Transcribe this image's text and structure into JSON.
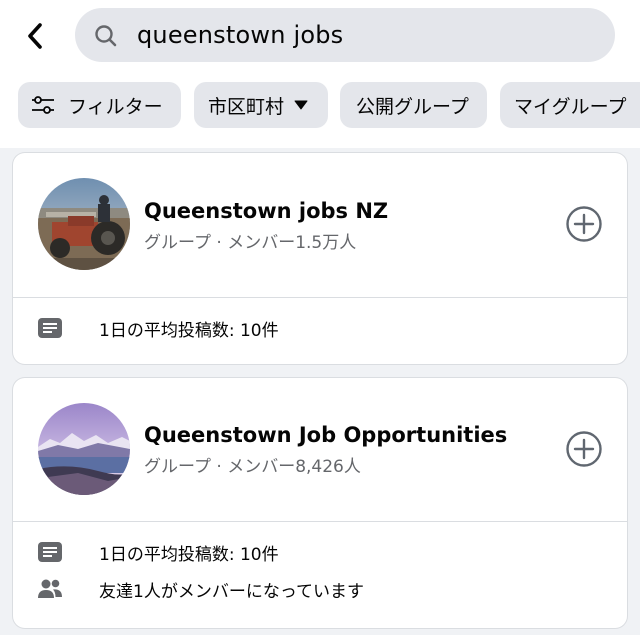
{
  "header": {
    "back_icon": "chevron-left-icon",
    "search": {
      "icon": "search-icon",
      "query": "queenstown jobs"
    }
  },
  "filters": [
    {
      "label": "フィルター",
      "icon": "sliders-icon"
    },
    {
      "label": "市区町村",
      "icon": "caret-down-icon"
    },
    {
      "label": "公開グループ"
    },
    {
      "label": "マイグループ"
    }
  ],
  "results": [
    {
      "name": "Queenstown jobs NZ",
      "meta": "グループ · メンバー1.5万人",
      "avatar": "tractor-photo",
      "join_icon": "plus-circle-icon",
      "details": [
        {
          "icon": "post-icon",
          "text": "1日の平均投稿数: 10件"
        }
      ]
    },
    {
      "name": "Queenstown Job Opportunities",
      "meta": "グループ · メンバー8,426人",
      "avatar": "mountain-lake-photo",
      "join_icon": "plus-circle-icon",
      "details": [
        {
          "icon": "post-icon",
          "text": "1日の平均投稿数: 10件"
        },
        {
          "icon": "friends-icon",
          "text": "友達1人がメンバーになっています"
        }
      ]
    }
  ],
  "colors": {
    "background": "#f0f2f5",
    "chip": "#e4e6eb",
    "secondary_text": "#65676b",
    "icon_gray": "#606770"
  }
}
